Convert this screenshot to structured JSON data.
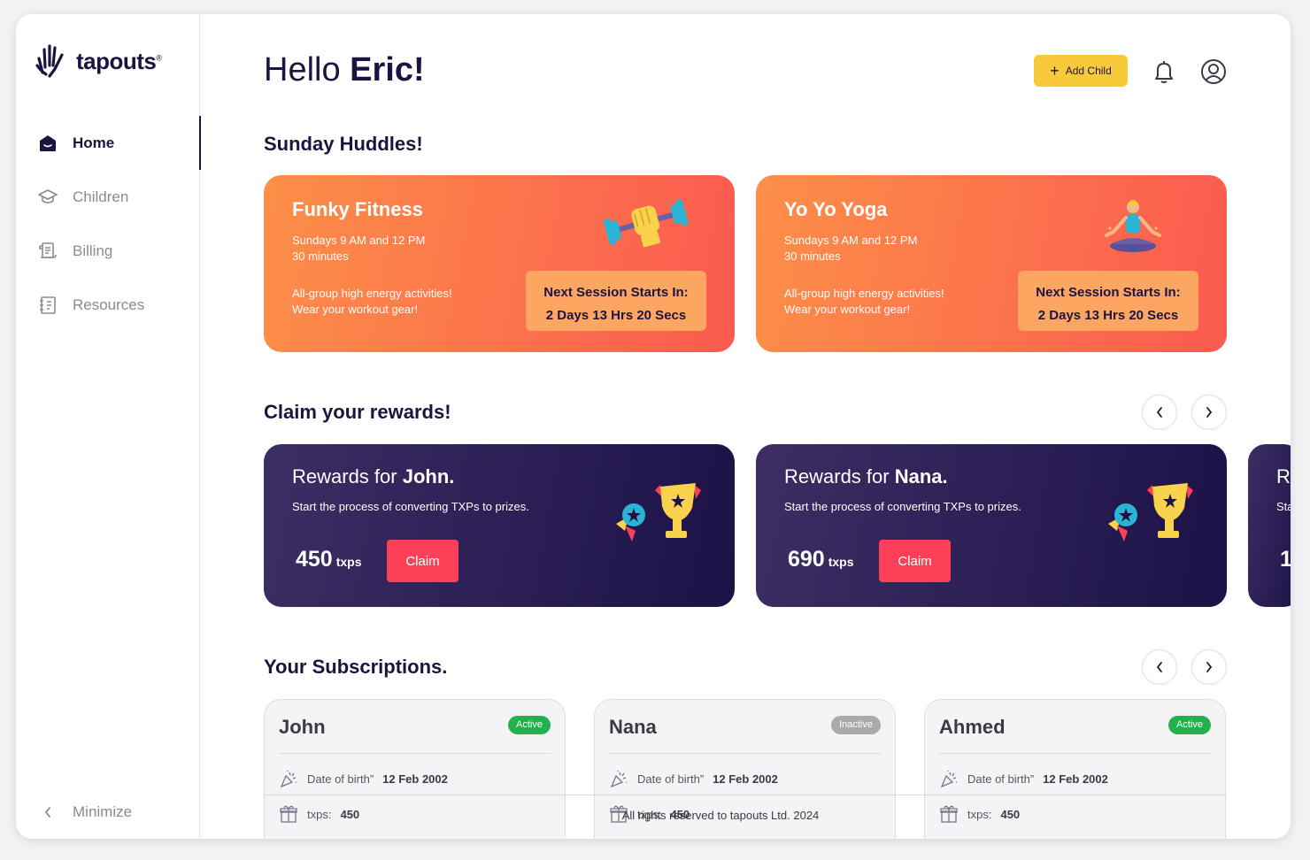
{
  "brand": {
    "name": "tapouts",
    "mark": "®"
  },
  "sidebar": {
    "items": [
      {
        "label": "Home",
        "icon": "home-icon",
        "active": true
      },
      {
        "label": "Children",
        "icon": "graduation-cap-icon",
        "active": false
      },
      {
        "label": "Billing",
        "icon": "scroll-icon",
        "active": false
      },
      {
        "label": "Resources",
        "icon": "notebook-icon",
        "active": false
      }
    ],
    "minimize_label": "Minimize"
  },
  "header": {
    "greeting_prefix": "Hello ",
    "greeting_name": "Eric!",
    "add_child_label": "Add Child"
  },
  "huddles": {
    "title": "Sunday Huddles!",
    "cards": [
      {
        "title": "Funky Fitness",
        "schedule": "Sundays 9 AM and 12 PM",
        "duration": "30 minutes",
        "desc1": "All-group high energy activities!",
        "desc2": "Wear your workout gear!",
        "timer_label": "Next Session Starts In:",
        "timer_value": "2 Days 13 Hrs 20 Secs",
        "illustration": "dumbbell-fist-icon"
      },
      {
        "title": "Yo Yo Yoga",
        "schedule": "Sundays 9 AM and 12 PM",
        "duration": "30 minutes",
        "desc1": "All-group high energy activities!",
        "desc2": "Wear your workout gear!",
        "timer_label": "Next Session Starts In:",
        "timer_value": "2 Days 13 Hrs 20 Secs",
        "illustration": "yoga-person-icon"
      }
    ]
  },
  "rewards": {
    "title": "Claim your rewards!",
    "cards": [
      {
        "prefix": "Rewards for ",
        "name": "John.",
        "subtitle": "Start the process of converting TXPs to prizes.",
        "points": "450",
        "unit": "txps",
        "claim_label": "Claim"
      },
      {
        "prefix": "Rewards for ",
        "name": "Nana.",
        "subtitle": "Start the process of converting TXPs to prizes.",
        "points": "690",
        "unit": "txps",
        "claim_label": "Claim"
      }
    ],
    "partial_card": {
      "title": "R",
      "subtitle": "Sta",
      "points": "1"
    }
  },
  "subscriptions": {
    "title": "Your Subscriptions.",
    "cards": [
      {
        "name": "John",
        "status": "Active",
        "dob_label": "Date of birth”",
        "dob": "12 Feb 2002",
        "txps_label": "txps:",
        "txps": "450"
      },
      {
        "name": "Nana",
        "status": "Inactive",
        "dob_label": "Date of birth”",
        "dob": "12 Feb 2002",
        "txps_label": "txps:",
        "txps": "450"
      },
      {
        "name": "Ahmed",
        "status": "Active",
        "dob_label": "Date of birth”",
        "dob": "12 Feb 2002",
        "txps_label": "txps:",
        "txps": "450"
      }
    ]
  },
  "footer": {
    "text": "All rights reserved to tapouts Ltd. 2024"
  },
  "colors": {
    "accent": "#f8c93b",
    "navy": "#1c1440",
    "active": "#22b14c",
    "inactive": "#aaaaaa",
    "claim": "#fb4058",
    "huddle_start": "#fc8f48",
    "huddle_end": "#fb5a50"
  }
}
